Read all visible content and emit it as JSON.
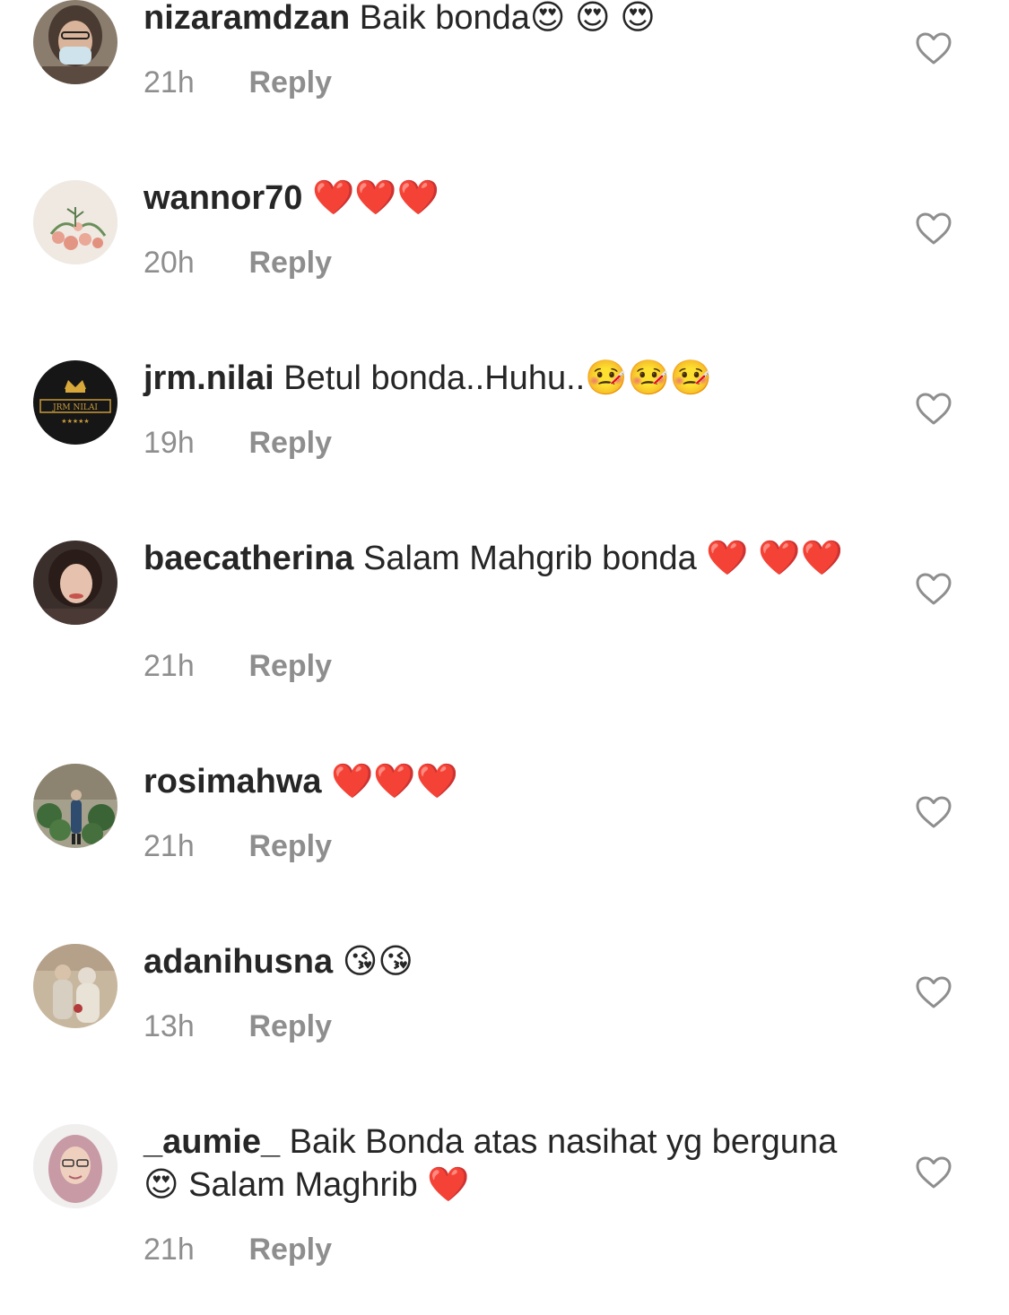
{
  "comments": [
    {
      "username": "nizaramdzan",
      "message": "Baik bonda😍 😍 😍",
      "time": "21h",
      "reply_label": "Reply"
    },
    {
      "username": "wannor70",
      "message": " ❤️❤️❤️",
      "time": "20h",
      "reply_label": "Reply"
    },
    {
      "username": "jrm.nilai",
      "message": "Betul bonda..Huhu..🤒🤒🤒",
      "time": "19h",
      "reply_label": "Reply",
      "avatar_text": "JRM NILAI"
    },
    {
      "username": "baecatherina",
      "message": "Salam Mahgrib bonda ❤️ ❤️❤️",
      "time": "21h",
      "reply_label": "Reply"
    },
    {
      "username": "rosimahwa",
      "message": " ❤️❤️❤️",
      "time": "21h",
      "reply_label": "Reply"
    },
    {
      "username": "adanihusna",
      "message": " 😘😘",
      "time": "13h",
      "reply_label": "Reply"
    },
    {
      "username": "_aumie_",
      "message": "Baik Bonda atas nasihat yg berguna 😍 Salam Maghrib ❤️",
      "time": "21h",
      "reply_label": "Reply"
    }
  ],
  "icons": {
    "like": "heart-outline-icon"
  },
  "colors": {
    "text": "#262626",
    "secondary": "#8e8e8e",
    "background": "#ffffff"
  }
}
